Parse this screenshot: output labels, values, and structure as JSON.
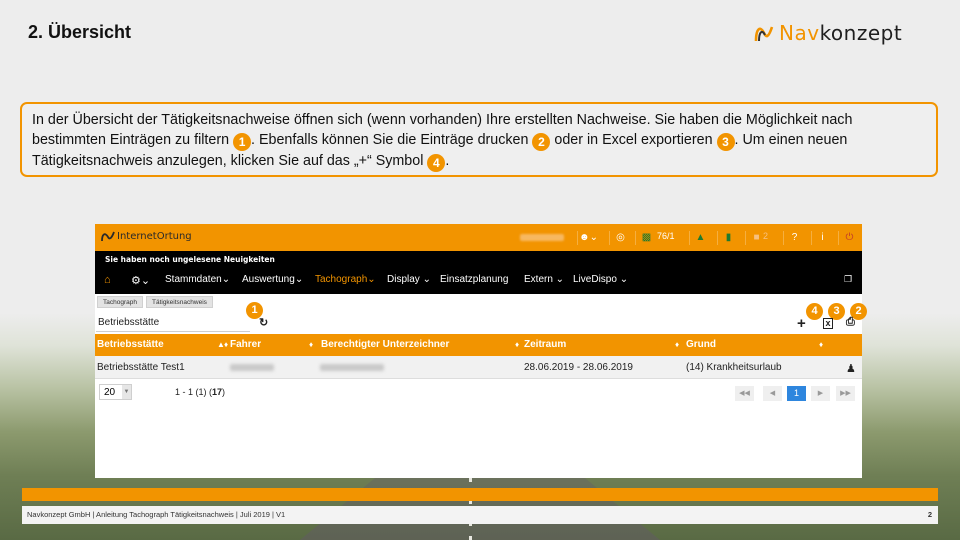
{
  "slide": {
    "title": "2. Übersicht",
    "logo": {
      "part1": "Nav",
      "part2": "konzept"
    },
    "description": {
      "seg1": "In der Übersicht der  Tätigkeitsnachweise öffnen sich (wenn vorhanden) Ihre erstellten Nachweise. Sie haben die Möglichkeit nach bestimmten Einträgen zu filtern ",
      "seg2": ". Ebenfalls können Sie die Einträge drucken ",
      "seg3": " oder in Excel exportieren ",
      "seg4": ". Um einen neuen Tätigkeitsnachweis anzulegen, klicken Sie auf das „+“ Symbol ",
      "seg5": ".",
      "badges": [
        "1",
        "2",
        "3",
        "4"
      ]
    },
    "footer": {
      "text": "Navkonzept GmbH  |  Anleitung Tachograph Tätigkeitsnachweis  |  Juli 2019  |  V1",
      "page": "2"
    },
    "accent_color": "#f29400"
  },
  "app": {
    "logo_text": "InternetOrtung",
    "counter": "76/1",
    "alert_count": "2",
    "news": "Sie haben noch ungelesene Neuigkeiten",
    "nav": {
      "items": [
        "Stammdaten",
        "Auswertung",
        "Tachograph",
        "Display",
        "Einsatzplanung",
        "Extern",
        "LiveDispo"
      ],
      "active": "Tachograph"
    },
    "breadcrumbs": [
      "Tachograph",
      "Tätigkeitsnachweis"
    ],
    "filter": {
      "value": "Betriebsstätte"
    },
    "callouts": {
      "filter": "1",
      "add": "4",
      "excel": "3",
      "print": "2"
    },
    "grid": {
      "columns": [
        "Betriebsstätte",
        "Fahrer",
        "Berechtigter Unterzeichner",
        "Zeitraum",
        "Grund"
      ],
      "rows": [
        {
          "betriebsstaette": "Betriebsstätte Test1",
          "zeitraum": "28.06.2019 - 28.06.2019",
          "grund": "(14) Krankheitsurlaub"
        }
      ]
    },
    "pager": {
      "page_size": "20",
      "info_prefix": "1 - 1 (1) (",
      "info_total": "17",
      "info_suffix": ")",
      "current_page": "1"
    }
  }
}
